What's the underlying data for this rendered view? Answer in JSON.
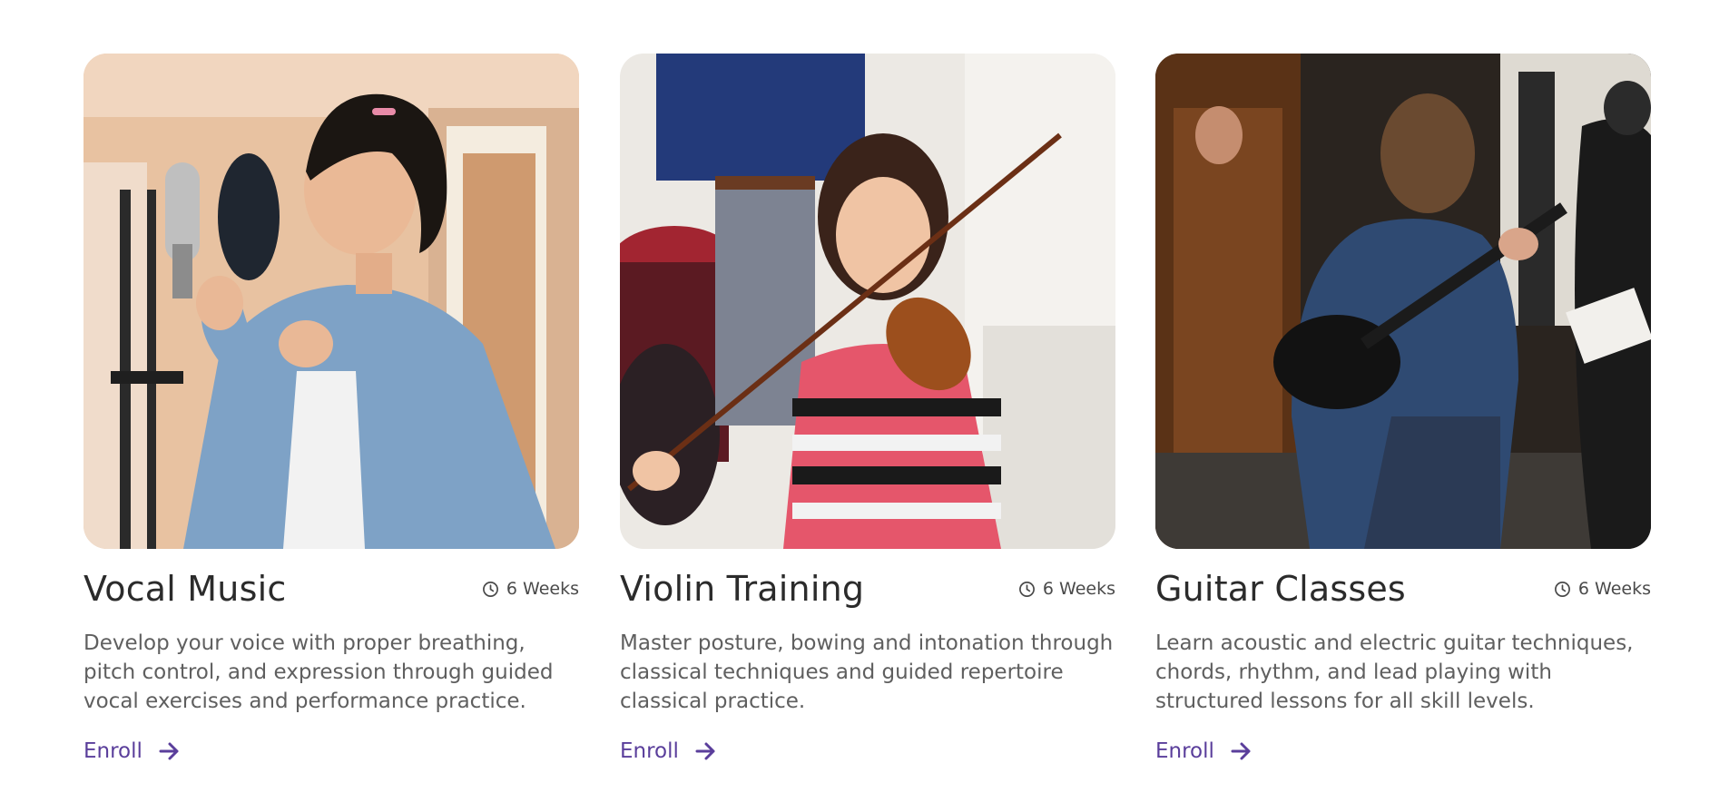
{
  "courses": [
    {
      "title": "Vocal Music",
      "duration": "6 Weeks",
      "description": "Develop your voice with proper breathing, pitch control, and expression through guided vocal exercises and performance practice.",
      "cta": "Enroll",
      "photo": "singer-at-microphone"
    },
    {
      "title": "Violin Training",
      "duration": "6 Weeks",
      "description": "Master posture, bowing and intonation through classical techniques and guided repertoire classical practice.",
      "cta": "Enroll",
      "photo": "girl-playing-violin"
    },
    {
      "title": "Guitar Classes",
      "duration": "6 Weeks",
      "description": "Learn acoustic and electric guitar techniques, chords, rhythm, and lead playing with structured lessons for all skill levels.",
      "cta": "Enroll",
      "photo": "guitar-lesson"
    }
  ],
  "colors": {
    "accent": "#5a3e9b",
    "title": "#2b2b2b",
    "body": "#5f5f5f"
  },
  "icons": {
    "duration": "clock-icon",
    "cta": "arrow-right-icon"
  }
}
